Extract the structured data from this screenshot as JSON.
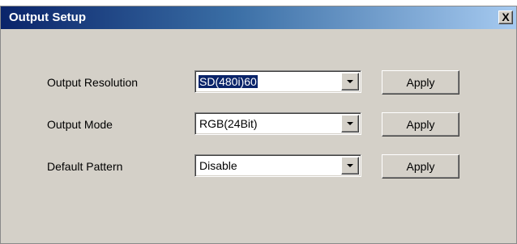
{
  "window": {
    "title": "Output Setup",
    "close_label": "X"
  },
  "settings": [
    {
      "label": "Output Resolution",
      "value": "SD(480i)60",
      "value_selected": true,
      "apply_label": "Apply"
    },
    {
      "label": "Output Mode",
      "value": "RGB(24Bit)",
      "value_selected": false,
      "apply_label": "Apply"
    },
    {
      "label": "Default Pattern",
      "value": "Disable",
      "value_selected": false,
      "apply_label": "Apply"
    }
  ],
  "colors": {
    "titlebar_start": "#0a246a",
    "titlebar_end": "#a6caf0",
    "dialog_background": "#d4d0c8",
    "selection_highlight": "#0a246a"
  },
  "icons": {
    "close": "close-icon",
    "dropdown": "chevron-down-icon"
  }
}
